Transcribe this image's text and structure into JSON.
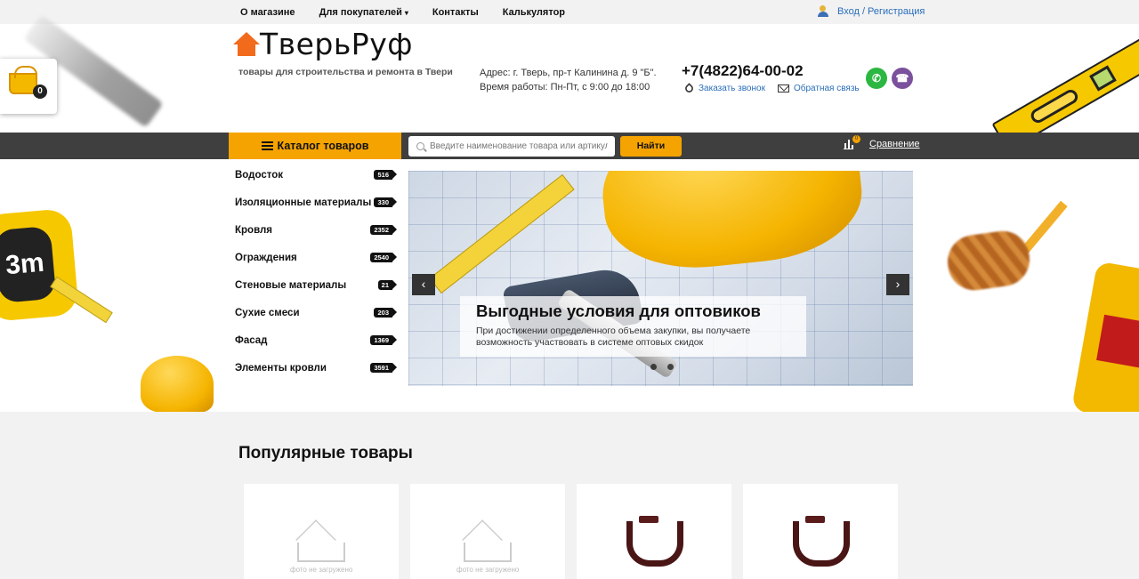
{
  "topnav": {
    "items": [
      "О магазине",
      "Для покупателей",
      "Контакты",
      "Калькулятор"
    ],
    "dropdown_caret": "▾",
    "login_label": "Вход / Регистрация"
  },
  "cart": {
    "count": "0"
  },
  "logo": {
    "name": "ТверьРуф",
    "tagline": "товары для строительства и ремонта в Твери"
  },
  "contacts": {
    "address": "Адрес: г. Тверь, пр-т Калинина д. 9 \"Б\".",
    "hours": "Время работы: Пн-Пт, с 9:00 до 18:00",
    "phone": "+7(4822)64-00-02",
    "callback_label": "Заказать звонок",
    "feedback_label": "Обратная связь"
  },
  "social": {
    "whatsapp_icon": "whatsapp-icon",
    "viber_icon": "viber-icon"
  },
  "catalog_bar": {
    "catalog_label": "Каталог товаров",
    "search_placeholder": "Введите наименование товара или артикул",
    "search_button": "Найти",
    "compare_label": "Сравнение",
    "compare_count": "0"
  },
  "categories": [
    {
      "label": "Водосток",
      "count": "516"
    },
    {
      "label": "Изоляционные материалы",
      "count": "330"
    },
    {
      "label": "Кровля",
      "count": "2352"
    },
    {
      "label": "Ограждения",
      "count": "2540"
    },
    {
      "label": "Стеновые материалы",
      "count": "21"
    },
    {
      "label": "Сухие смеси",
      "count": "203"
    },
    {
      "label": "Фасад",
      "count": "1369"
    },
    {
      "label": "Элементы кровли",
      "count": "3591"
    }
  ],
  "slider": {
    "title": "Выгодные условия для оптовиков",
    "description": "При достижении определенного объема закупки, вы получаете возможность участвовать в системе оптовых скидок",
    "prev": "‹",
    "next": "›"
  },
  "popular": {
    "title": "Популярные товары",
    "no_photo": "фото не загружено"
  },
  "colors": {
    "accent": "#f5a300",
    "dark_bar": "#3f3f3f",
    "link": "#2a6ebb"
  }
}
